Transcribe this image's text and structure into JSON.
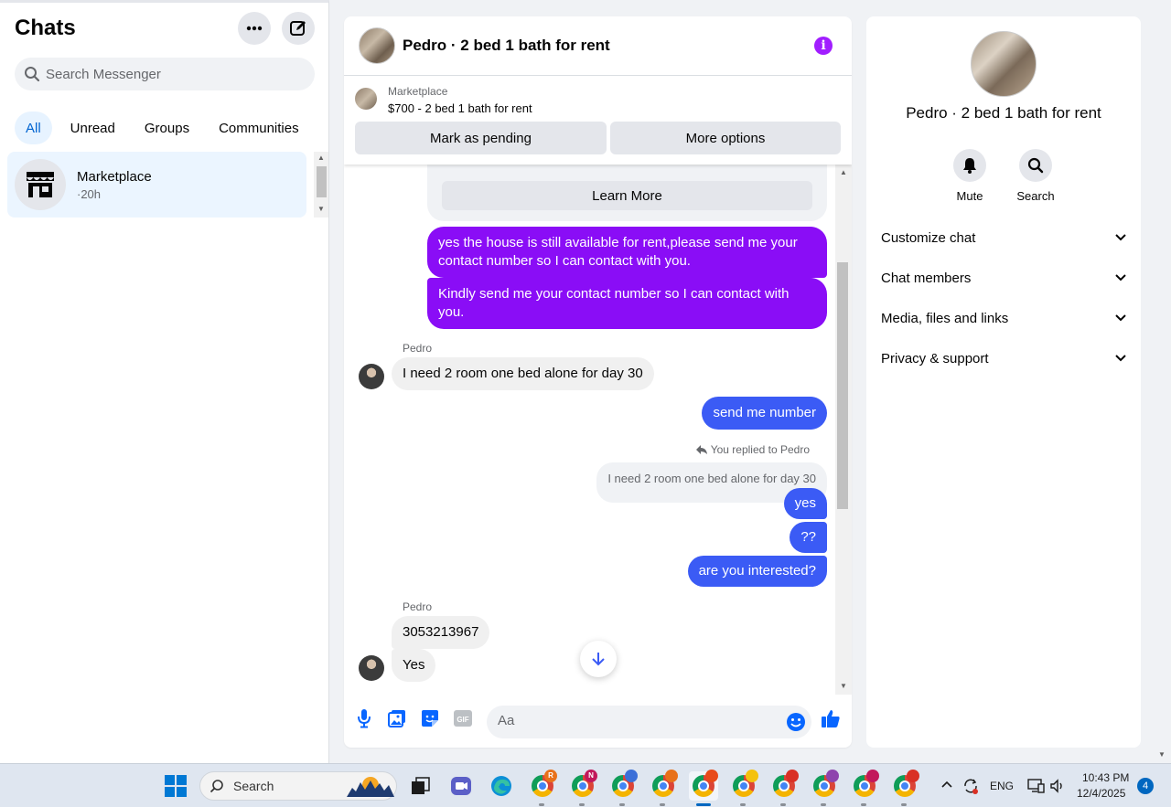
{
  "sidebar": {
    "title": "Chats",
    "search_placeholder": "Search Messenger",
    "filters": [
      "All",
      "Unread",
      "Groups",
      "Communities"
    ],
    "chats": [
      {
        "name": "Marketplace",
        "time": "·20h",
        "icon": "storefront-icon"
      }
    ]
  },
  "conversation": {
    "title": "Pedro · 2 bed 1 bath for rent",
    "marketplace": {
      "label": "Marketplace",
      "listing": "$700 - 2 bed 1 bath for rent",
      "mark_pending": "Mark as pending",
      "more_options": "More options"
    },
    "learn_more": "Learn More",
    "messages": {
      "out1": "yes the house is still available for rent,please send me your contact number so I can contact with you.",
      "out2": "Kindly send me your contact number so I can contact with you.",
      "sender1": "Pedro",
      "in1": "I need 2 room one bed alone for day 30",
      "out3": "send me number",
      "replied_label": "You replied to Pedro",
      "reply_quote": "I need 2 room one bed alone for day 30",
      "out4": "yes",
      "out5": "??",
      "out6": "are you interested?",
      "sender2": "Pedro",
      "in2": "3053213967",
      "in3": "Yes"
    },
    "composer_placeholder": "Aa"
  },
  "info_panel": {
    "title": "Pedro · 2 bed 1 bath for rent",
    "actions": [
      {
        "label": "Mute",
        "icon": "bell-icon"
      },
      {
        "label": "Search",
        "icon": "search-icon"
      }
    ],
    "sections": [
      "Customize chat",
      "Chat members",
      "Media, files and links",
      "Privacy & support"
    ]
  },
  "taskbar": {
    "search_label": "Search",
    "language": "ENG",
    "time": "10:43 PM",
    "date": "12/4/2025",
    "notification_count": "4",
    "badges": [
      "R",
      "N"
    ]
  },
  "colors": {
    "accent_purple": "#8a0df6",
    "accent_blue": "#3b5bf5",
    "link_blue": "#0064d1"
  }
}
